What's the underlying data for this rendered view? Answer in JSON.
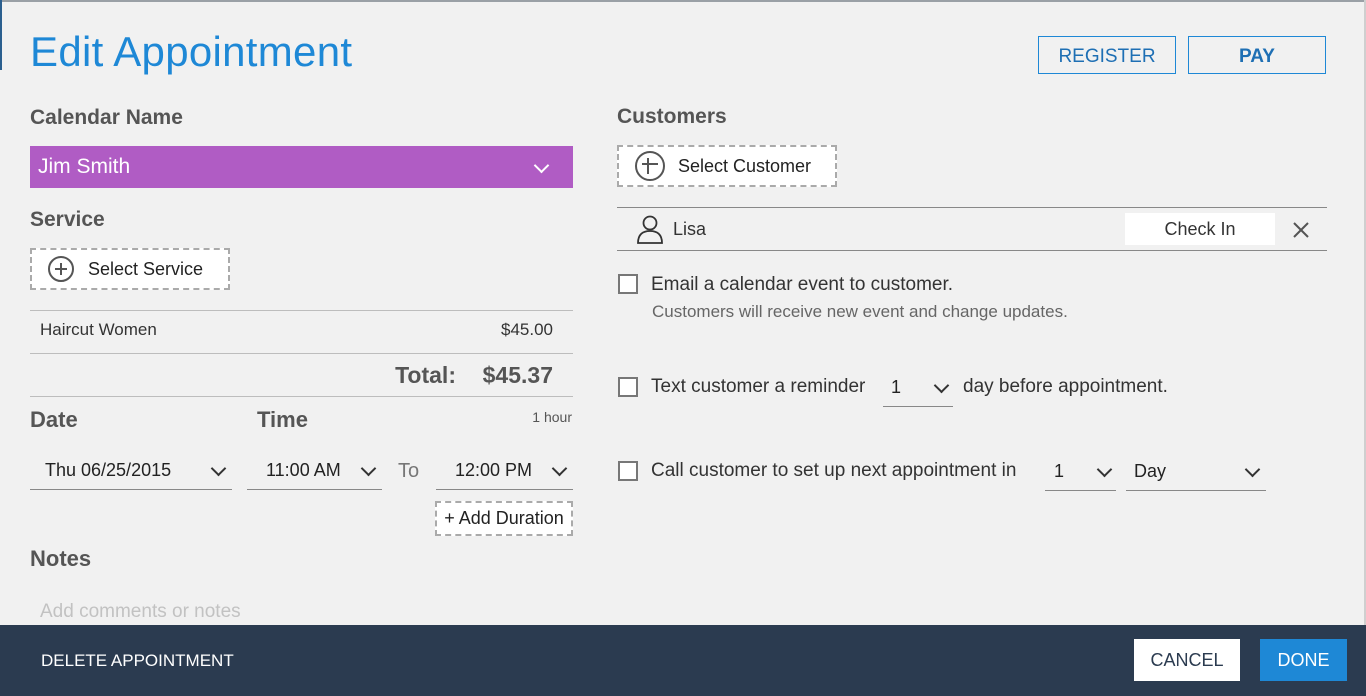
{
  "header": {
    "title": "Edit Appointment",
    "register_label": "REGISTER",
    "pay_label": "PAY"
  },
  "calendar": {
    "label": "Calendar Name",
    "selected": "Jim Smith",
    "color": "#b05cc4"
  },
  "service": {
    "label": "Service",
    "select_label": "Select Service",
    "items": [
      {
        "name": "Haircut Women",
        "price": "$45.00"
      }
    ],
    "total_label": "Total:",
    "total_value": "$45.37"
  },
  "datetime": {
    "date_label": "Date",
    "time_label": "Time",
    "duration": "1 hour",
    "date_value": "Thu 06/25/2015",
    "start_time": "11:00 AM",
    "to_label": "To",
    "end_time": "12:00 PM",
    "add_duration_label": "+ Add Duration"
  },
  "notes": {
    "label": "Notes",
    "placeholder": "Add comments or notes"
  },
  "customers": {
    "label": "Customers",
    "select_label": "Select Customer",
    "list": [
      {
        "name": "Lisa",
        "checkin_label": "Check In"
      }
    ]
  },
  "options": {
    "email_label": "Email a calendar event to customer.",
    "email_sub": "Customers will receive new event and change updates.",
    "text_prefix": "Text customer a reminder",
    "text_value": "1",
    "text_suffix": "day before appointment.",
    "call_prefix": "Call customer to set up next appointment in",
    "call_value": "1",
    "call_unit": "Day"
  },
  "footer": {
    "delete_label": "DELETE APPOINTMENT",
    "cancel_label": "CANCEL",
    "done_label": "DONE"
  },
  "colors": {
    "accent": "#1e88d6",
    "footer_bg": "#2b3b50",
    "done_bg": "#1e88d6"
  },
  "icons": {
    "add": "plus-circle-icon",
    "chevron": "chevron-down-icon",
    "user": "user-icon",
    "close": "close-icon"
  }
}
